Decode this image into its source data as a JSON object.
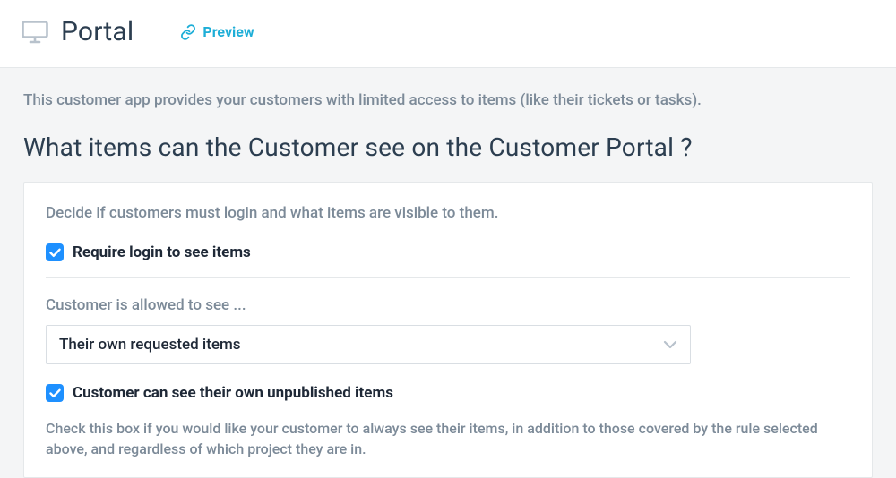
{
  "header": {
    "title": "Portal",
    "preview_label": "Preview"
  },
  "content": {
    "description": "This customer app provides your customers with limited access to items (like their tickets or tasks).",
    "section_heading": "What items can the Customer see on the Customer Portal ?"
  },
  "card": {
    "intro": "Decide if customers must login and what items are visible to them.",
    "require_login_label": "Require login to see items",
    "require_login_checked": true,
    "allowed_heading": "Customer is allowed to see ...",
    "allowed_selected": "Their own requested items",
    "unpublished_label": "Customer can see their own unpublished items",
    "unpublished_checked": true,
    "unpublished_help": "Check this box if you would like your customer to always see their items, in addition to those covered by the rule selected above, and regardless of which project they are in."
  }
}
